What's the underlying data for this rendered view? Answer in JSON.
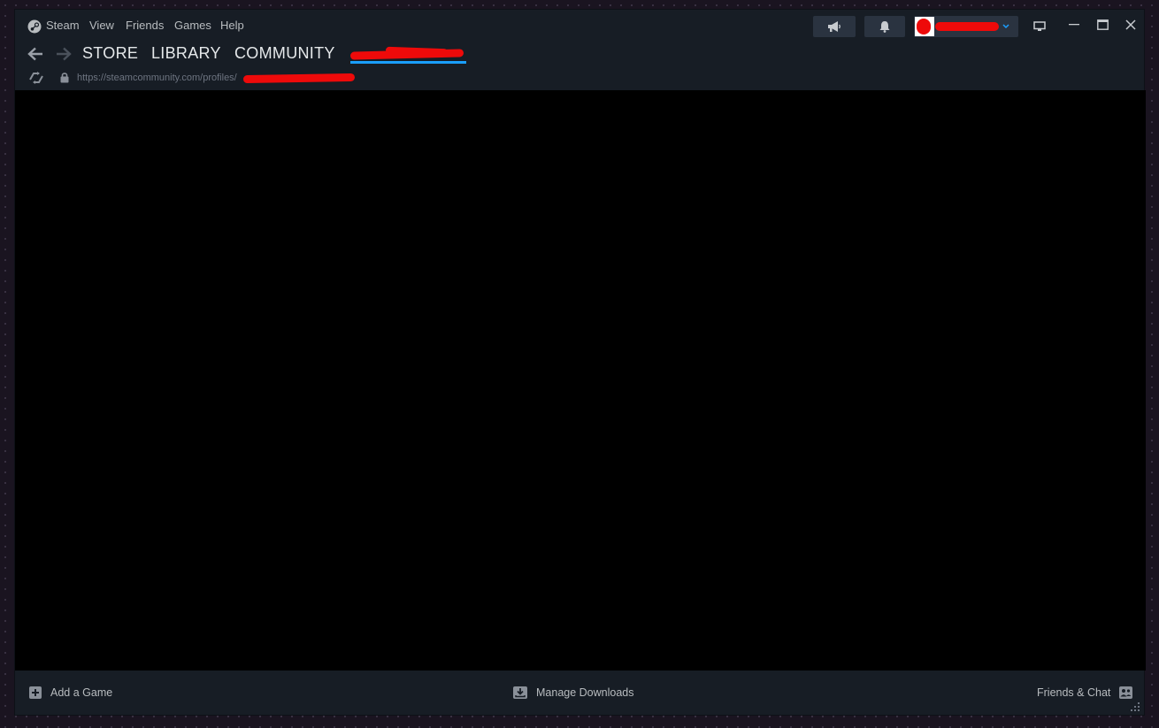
{
  "menubar": {
    "app_name": "Steam",
    "items": [
      "View",
      "Friends",
      "Games",
      "Help"
    ]
  },
  "nav": {
    "tabs": [
      "STORE",
      "LIBRARY",
      "COMMUNITY"
    ]
  },
  "url": {
    "text": "https://steamcommunity.com/profiles/"
  },
  "bottombar": {
    "add_game": "Add a Game",
    "manage_downloads": "Manage Downloads",
    "friends_chat": "Friends & Chat"
  },
  "colors": {
    "accent": "#1a9fff",
    "window_bg": "#171d25",
    "content_bg": "#000000",
    "redaction": "#ee0a0a"
  }
}
